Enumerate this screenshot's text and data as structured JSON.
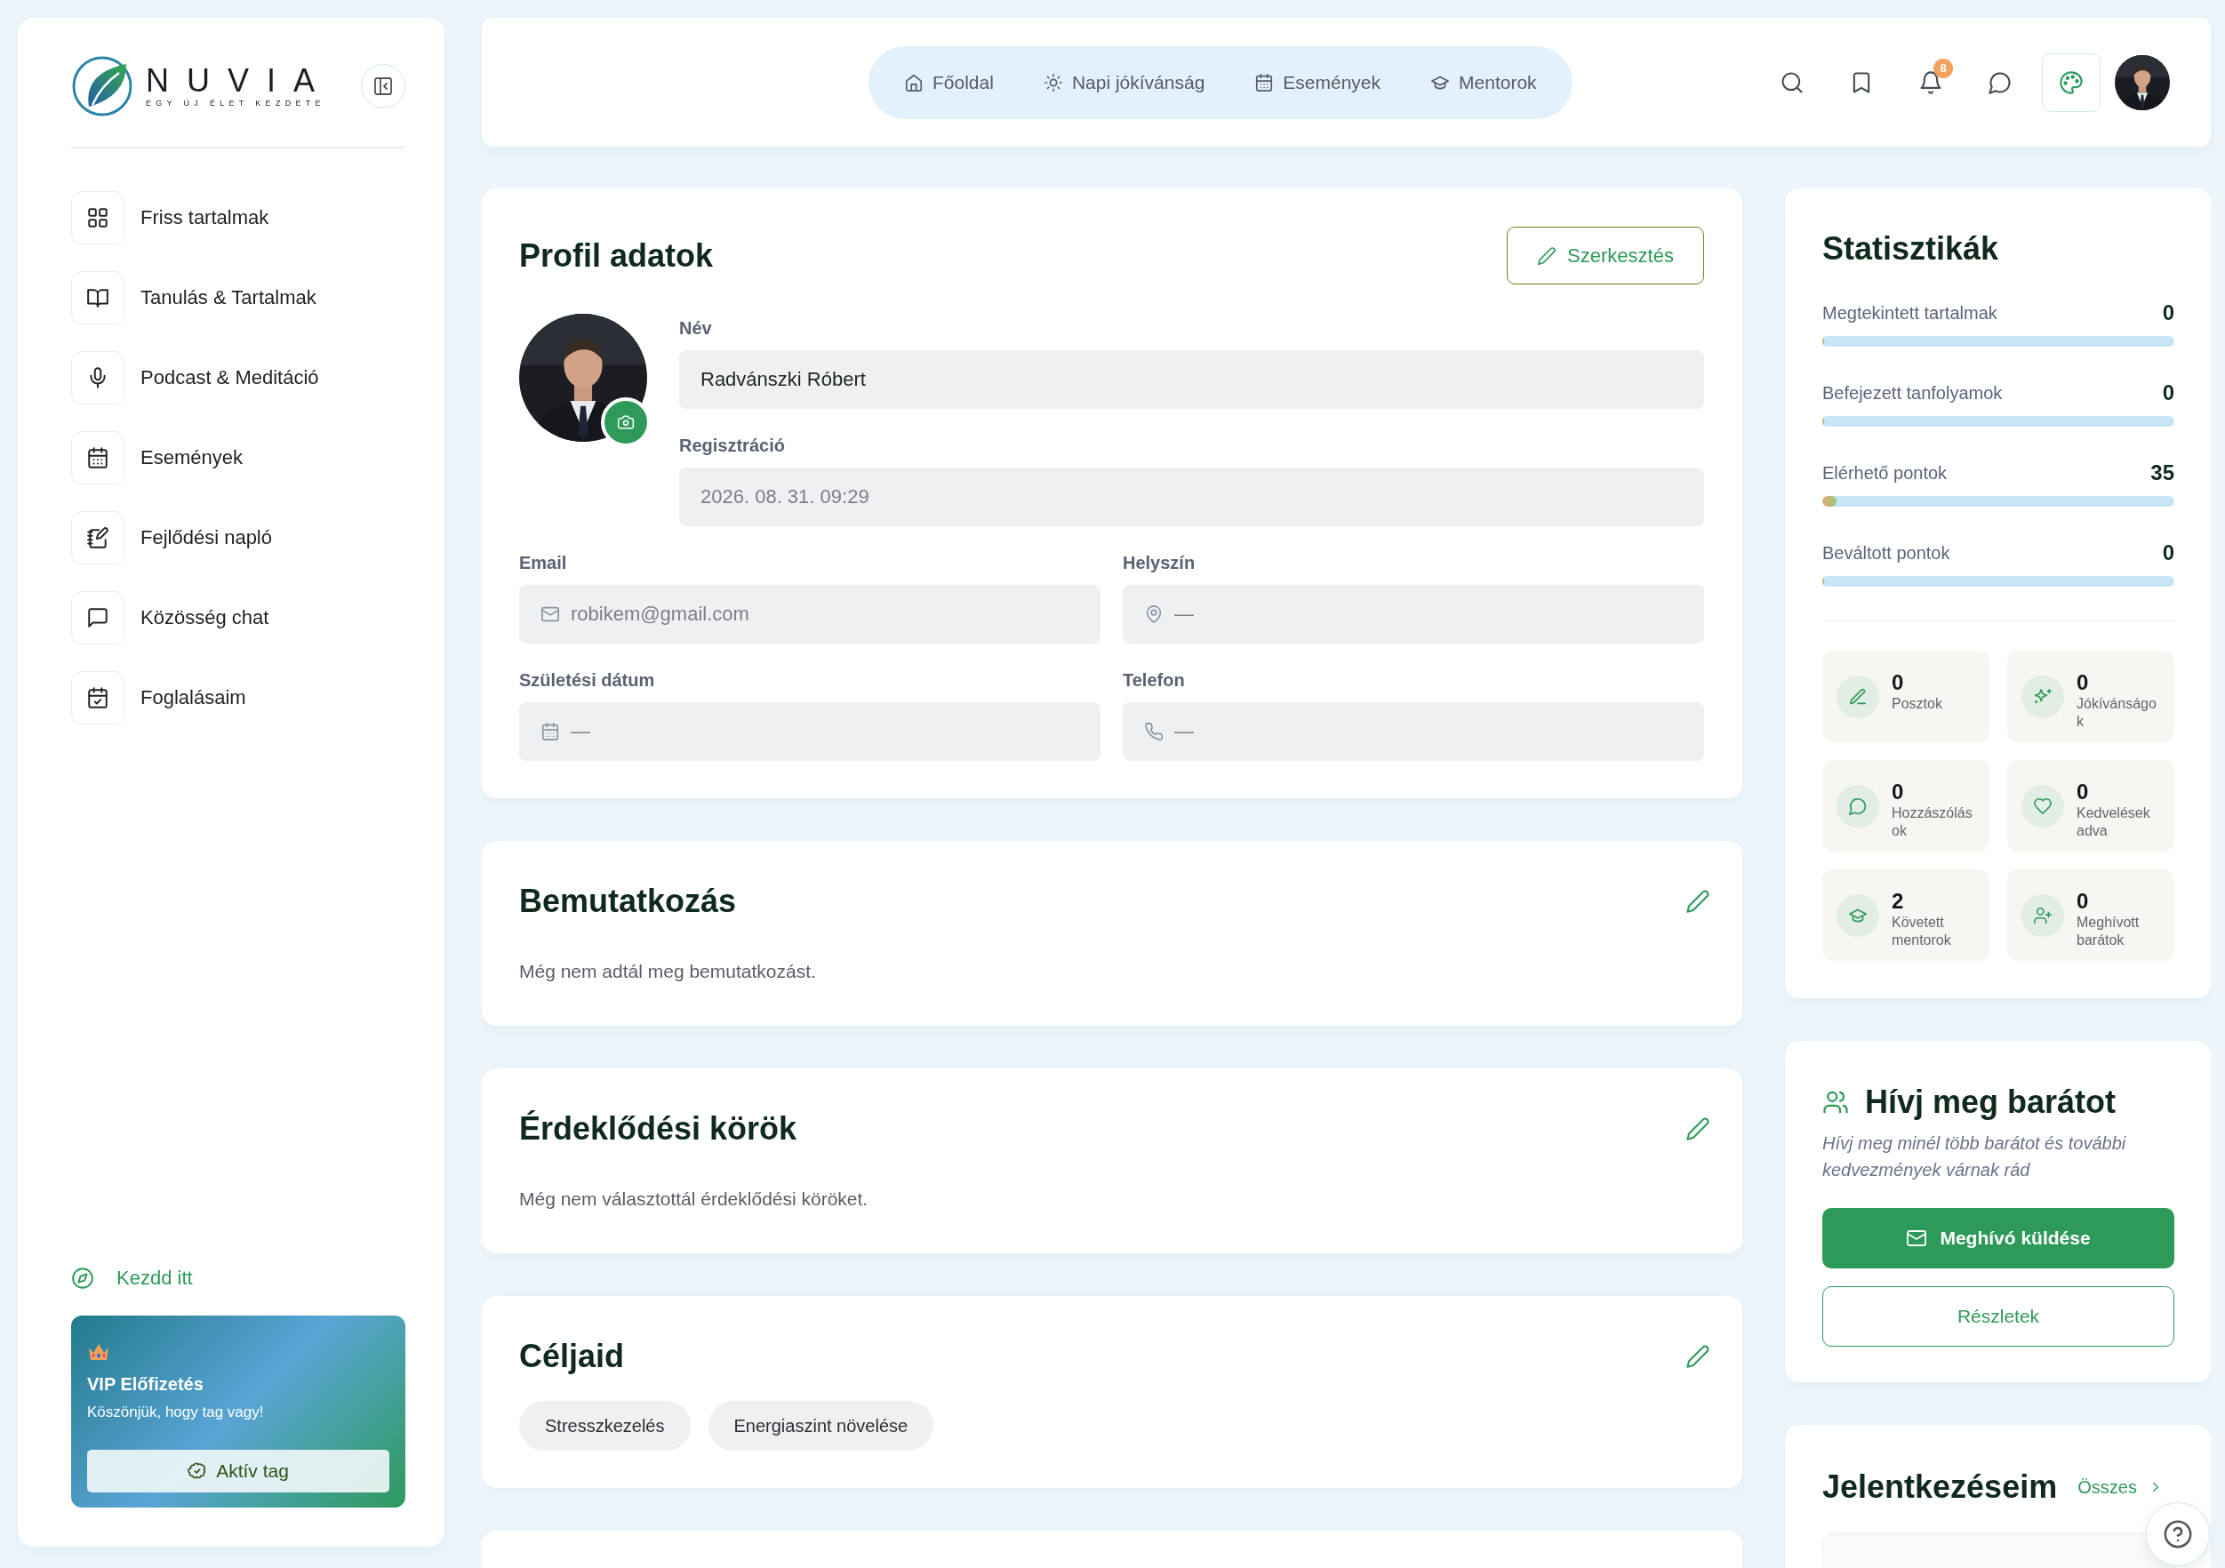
{
  "sidebar": {
    "brand": {
      "name": "NUVIA",
      "tagline": "EGY ÚJ ÉLET KEZDETE"
    },
    "items": [
      {
        "label": "Friss tartalmak"
      },
      {
        "label": "Tanulás & Tartalmak"
      },
      {
        "label": "Podcast & Meditáció"
      },
      {
        "label": "Események"
      },
      {
        "label": "Fejlődési napló"
      },
      {
        "label": "Közösség chat"
      },
      {
        "label": "Foglalásaim"
      }
    ],
    "start_link": "Kezdd itt",
    "membership": {
      "title": "VIP Előfizetés",
      "message": "Köszönjük, hogy tag vagy!",
      "status": "Aktív tag"
    }
  },
  "header": {
    "nav": [
      {
        "label": "Főoldal"
      },
      {
        "label": "Napi jókívánság"
      },
      {
        "label": "Események"
      },
      {
        "label": "Mentorok"
      }
    ],
    "notification_count": "8"
  },
  "profile": {
    "title": "Profil adatok",
    "edit_button": "Szerkesztés",
    "fields": [
      {
        "label": "Név",
        "value": "Radvánszki Róbert",
        "disabled": false
      },
      {
        "label": "Regisztráció",
        "value": "2026. 08. 31. 09:29",
        "disabled": true
      },
      {
        "label": "Email",
        "value": "robikem@gmail.com",
        "disabled": true
      },
      {
        "label": "Helyszín",
        "value": "—",
        "disabled": true
      },
      {
        "label": "Születési dátum",
        "value": "—",
        "disabled": true
      },
      {
        "label": "Telefon",
        "value": "—",
        "disabled": true
      }
    ]
  },
  "sections": [
    {
      "title": "Bemutatkozás",
      "text": "Még nem adtál meg bemutatkozást."
    },
    {
      "title": "Érdeklődési körök",
      "text": "Még nem választottál érdeklődési köröket."
    },
    {
      "title": "Céljaid",
      "tags": [
        "Stresszkezelés",
        "Energiaszint növelése"
      ]
    }
  ],
  "stats": {
    "title": "Statisztikák",
    "rows": [
      {
        "label": "Megtekintett tartalmak",
        "value": "0",
        "level": 0
      },
      {
        "label": "Befejezett tanfolyamok",
        "value": "0",
        "level": 0
      },
      {
        "label": "Elérhető pontok",
        "value": "35",
        "level": 0.04
      },
      {
        "label": "Beváltott pontok",
        "value": "0",
        "level": 0
      }
    ],
    "tiles": [
      {
        "count": "0",
        "label": "Posztok"
      },
      {
        "count": "0",
        "label": "Jókívánságok"
      },
      {
        "count": "0",
        "label": "Hozzászólások"
      },
      {
        "count": "0",
        "label": "Kedvelések adva"
      },
      {
        "count": "2",
        "label": "Követett mentorok"
      },
      {
        "count": "0",
        "label": "Meghívott barátok"
      }
    ]
  },
  "invite": {
    "title": "Hívj meg barátot",
    "description": "Hívj meg minél több barátot és további kedvezmények várnak rád",
    "primary_button": "Meghívó küldése",
    "secondary_button": "Részletek"
  },
  "signups": {
    "title": "Jelentkezéseim",
    "link": "Összes"
  }
}
